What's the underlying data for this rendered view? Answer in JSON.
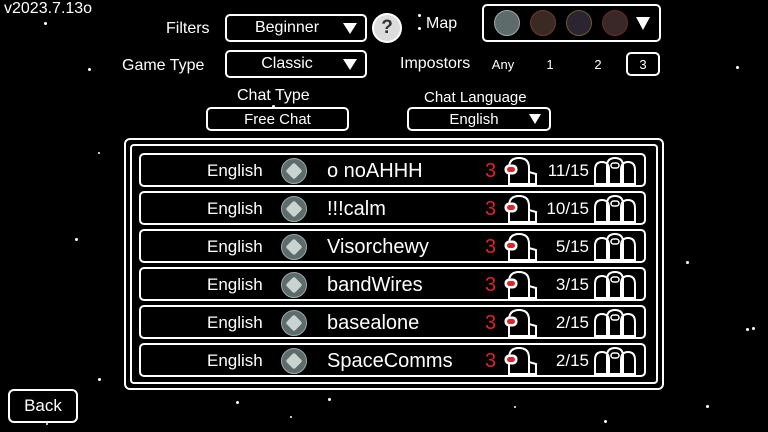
{
  "version": "v2023.7.13o",
  "filters": {
    "label": "Filters",
    "value": "Beginner"
  },
  "help_icon": "?",
  "map": {
    "label": "Map",
    "icons": [
      "skeld-icon",
      "mira-icon",
      "polus-icon",
      "airship-icon"
    ]
  },
  "game_type": {
    "label": "Game Type",
    "value": "Classic"
  },
  "impostors": {
    "label": "Impostors",
    "options": [
      "Any",
      "1",
      "2",
      "3"
    ],
    "selected": "3"
  },
  "chat_type": {
    "label": "Chat Type",
    "value": "Free Chat"
  },
  "chat_language": {
    "label": "Chat Language",
    "value": "English"
  },
  "games": [
    {
      "language": "English",
      "name": "o noAHHH",
      "impostors": "3",
      "players": "11/15"
    },
    {
      "language": "English",
      "name": "!!!calm",
      "impostors": "3",
      "players": "10/15"
    },
    {
      "language": "English",
      "name": "Visorchewy",
      "impostors": "3",
      "players": "5/15"
    },
    {
      "language": "English",
      "name": "bandWires",
      "impostors": "3",
      "players": "3/15"
    },
    {
      "language": "English",
      "name": "basealone",
      "impostors": "3",
      "players": "2/15"
    },
    {
      "language": "English",
      "name": "SpaceComms",
      "impostors": "3",
      "players": "2/15"
    }
  ],
  "back_label": "Back",
  "colors": {
    "impostor_count": "#e0232a",
    "background": "#000000",
    "outline": "#ffffff"
  }
}
